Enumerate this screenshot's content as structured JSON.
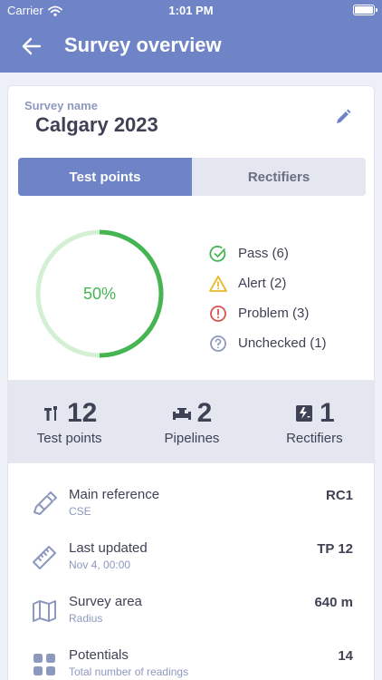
{
  "status_bar": {
    "carrier": "Carrier",
    "time": "1:01 PM"
  },
  "header": {
    "title": "Survey overview",
    "back_icon": "arrow-left-icon"
  },
  "survey": {
    "label": "Survey name",
    "name": "Calgary 2023",
    "edit_icon": "pencil-icon"
  },
  "tabs": [
    {
      "label": "Test points",
      "active": true
    },
    {
      "label": "Rectifiers",
      "active": false
    }
  ],
  "progress": {
    "label": "50%",
    "value": 0.5,
    "color": "#45b554",
    "track_color": "#d3f0d4"
  },
  "legend": [
    {
      "label": "Pass (6)",
      "icon": "check-circle-icon",
      "color": "#45b554"
    },
    {
      "label": "Alert (2)",
      "icon": "warning-triangle-icon",
      "color": "#e9b92a"
    },
    {
      "label": "Problem (3)",
      "icon": "exclamation-circle-icon",
      "color": "#d9534f"
    },
    {
      "label": "Unchecked (1)",
      "icon": "question-circle-icon",
      "color": "#8d98bf"
    }
  ],
  "stats": [
    {
      "value": "12",
      "label": "Test points",
      "icon": "test-point-icon"
    },
    {
      "value": "2",
      "label": "Pipelines",
      "icon": "pipeline-icon"
    },
    {
      "value": "1",
      "label": "Rectifiers",
      "icon": "rectifier-icon"
    }
  ],
  "info": [
    {
      "title": "Main reference",
      "subtitle": "CSE",
      "value": "RC1",
      "icon": "reference-probe-icon"
    },
    {
      "title": "Last updated",
      "subtitle": "Nov 4, 00:00",
      "value": "TP 12",
      "icon": "ruler-icon"
    },
    {
      "title": "Survey area",
      "subtitle": "Radius",
      "value": "640 m",
      "icon": "map-icon"
    },
    {
      "title": "Potentials",
      "subtitle": "Total number of readings",
      "value": "14",
      "icon": "grid-icon"
    }
  ],
  "colors": {
    "header": "#6f84c6",
    "accent": "#6f84c6",
    "icon": "#8d98bf",
    "text": "#3f4254"
  }
}
